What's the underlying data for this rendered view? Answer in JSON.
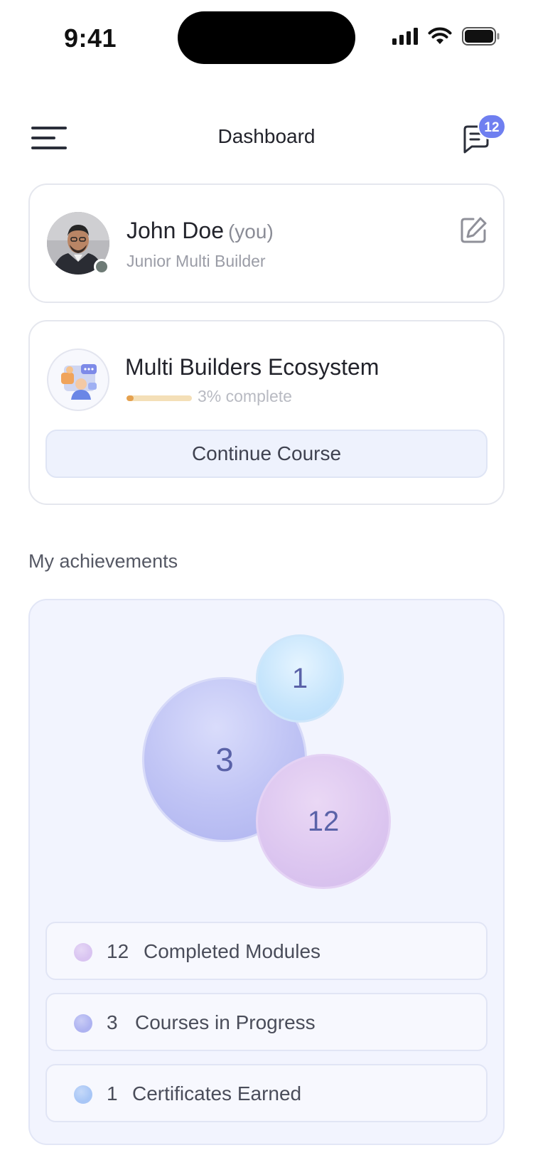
{
  "status_bar": {
    "time": "9:41"
  },
  "header": {
    "title": "Dashboard",
    "notifications_count": "12"
  },
  "profile": {
    "name": "John Doe",
    "you_tag": "(you)",
    "role": "Junior Multi Builder",
    "status": "online"
  },
  "course": {
    "title": "Multi Builders Ecosystem",
    "progress_percent": 3,
    "progress_label": "3% complete",
    "button_label": "Continue Course"
  },
  "achievements": {
    "section_title": "My achievements",
    "bubbles": {
      "courses": "3",
      "certificates": "1",
      "modules": "12"
    },
    "legend": [
      {
        "value": "12",
        "label": "Completed Modules",
        "color": "#d9c4f1"
      },
      {
        "value": "3",
        "label": "Courses in Progress",
        "color": "#aeb3f1"
      },
      {
        "value": "1",
        "label": "Certificates Earned",
        "color": "#a8c6f6"
      }
    ]
  },
  "colors": {
    "accent": "#6f7ff0",
    "progress": "#e5a14f",
    "achievements_bg": "#f2f4fe"
  }
}
